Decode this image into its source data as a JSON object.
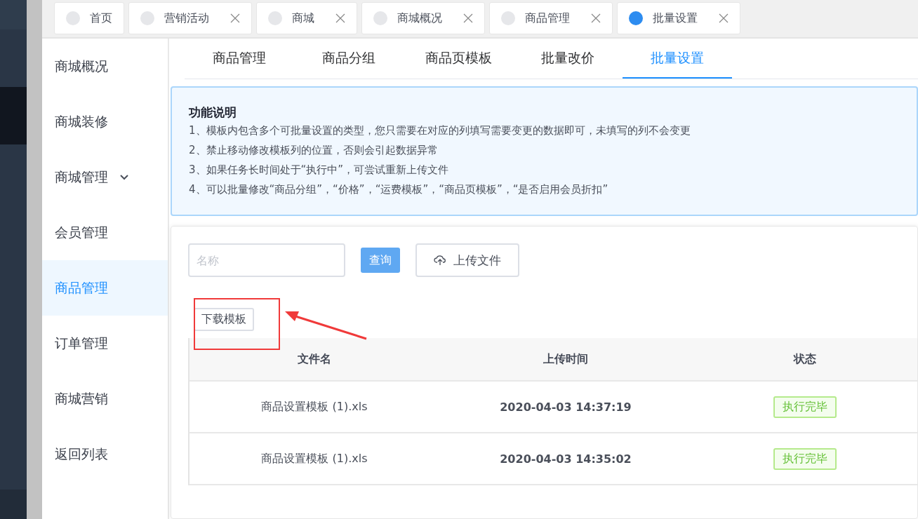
{
  "rail": {
    "items": [
      {
        "selected": false
      },
      {
        "selected": true
      },
      {
        "selected": false
      },
      {
        "selected": false
      },
      {
        "selected": false
      },
      {
        "selected": false
      },
      {
        "selected": false
      },
      {
        "selected": false
      }
    ]
  },
  "page_tabs": [
    {
      "label": "首页",
      "selected": false,
      "closable": false
    },
    {
      "label": "营销活动",
      "selected": false,
      "closable": true
    },
    {
      "label": "商城",
      "selected": false,
      "closable": true
    },
    {
      "label": "商城概况",
      "selected": false,
      "closable": true
    },
    {
      "label": "商品管理",
      "selected": false,
      "closable": true
    },
    {
      "label": "批量设置",
      "selected": true,
      "closable": true
    }
  ],
  "side_menu": [
    {
      "label": "商城概况",
      "selected": false
    },
    {
      "label": "商城装修",
      "selected": false
    },
    {
      "label": "商城管理",
      "selected": false,
      "expandable": true
    },
    {
      "label": "会员管理",
      "selected": false
    },
    {
      "label": "商品管理",
      "selected": true
    },
    {
      "label": "订单管理",
      "selected": false
    },
    {
      "label": "商城营销",
      "selected": false
    },
    {
      "label": "返回列表",
      "selected": false
    }
  ],
  "sub_tabs": [
    {
      "label": "商品管理",
      "selected": false
    },
    {
      "label": "商品分组",
      "selected": false
    },
    {
      "label": "商品页模板",
      "selected": false
    },
    {
      "label": "批量改价",
      "selected": false
    },
    {
      "label": "批量设置",
      "selected": true
    }
  ],
  "notice": {
    "title": "功能说明",
    "lines": [
      "1、模板内包含多个可批量设置的类型，您只需要在对应的列填写需要变更的数据即可，未填写的列不会变更",
      "2、禁止移动修改模板列的位置，否则会引起数据异常",
      "3、如果任务长时间处于“执行中”，可尝试重新上传文件",
      "4、可以批量修改“商品分组”，“价格”，“运费模板”，“商品页模板”，“是否启用会员折扣”"
    ]
  },
  "search": {
    "placeholder": "名称"
  },
  "query_button": "查询",
  "upload_button": "上传文件",
  "download_button": "下载模板",
  "table": {
    "columns": [
      "文件名",
      "上传时间",
      "状态"
    ],
    "rows": [
      {
        "file": "商品设置模板 (1).xls",
        "time": "2020-04-03 14:37:19",
        "status": "执行完毕"
      },
      {
        "file": "商品设置模板 (1).xls",
        "time": "2020-04-03 14:35:02",
        "status": "执行完毕"
      }
    ]
  }
}
